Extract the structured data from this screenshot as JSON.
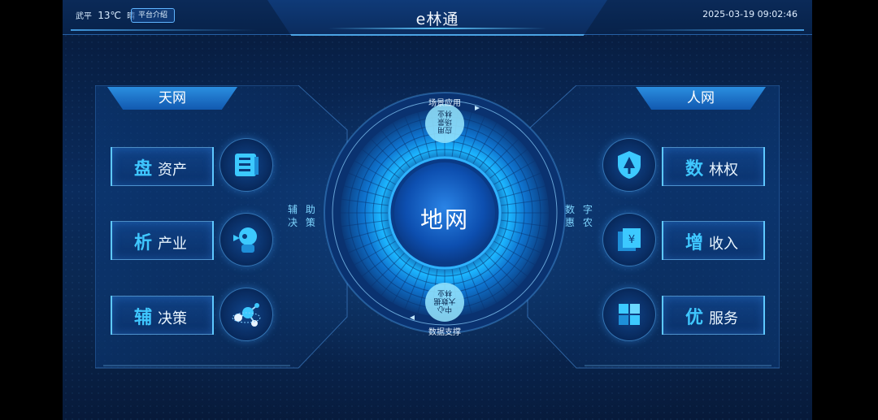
{
  "header": {
    "city": "武平",
    "temperature": "13℃",
    "weather": "晴",
    "intro_button": "平台介绍",
    "title": "e林通",
    "datetime": "2025-03-19 09:02:46"
  },
  "left_panel": {
    "tab": "天网",
    "items": [
      {
        "big": "盘",
        "small": "资产",
        "icon": "stack-layers-icon"
      },
      {
        "big": "析",
        "small": "产业",
        "icon": "robot-head-icon"
      },
      {
        "big": "辅",
        "small": "决策",
        "icon": "molecule-icon"
      }
    ],
    "side_label": [
      "辅 助",
      "决 策"
    ]
  },
  "right_panel": {
    "tab": "人网",
    "items": [
      {
        "big": "数",
        "small": "林权",
        "icon": "tree-shield-icon"
      },
      {
        "big": "增",
        "small": "收入",
        "icon": "money-box-icon"
      },
      {
        "big": "优",
        "small": "服务",
        "icon": "cube-cluster-icon"
      }
    ],
    "side_label": [
      "数 字",
      "惠 农"
    ]
  },
  "center": {
    "title": "地网",
    "top_arc_label": "场景应用",
    "bottom_arc_label": "数据支撑",
    "top_segment": [
      "应用",
      "场景",
      "林业"
    ],
    "bottom_segment": [
      "中心",
      "大数据",
      "林业"
    ]
  },
  "colors": {
    "accent": "#3fc7ff",
    "panel_blue": "#1259b0",
    "background": "#0a2b5c"
  }
}
